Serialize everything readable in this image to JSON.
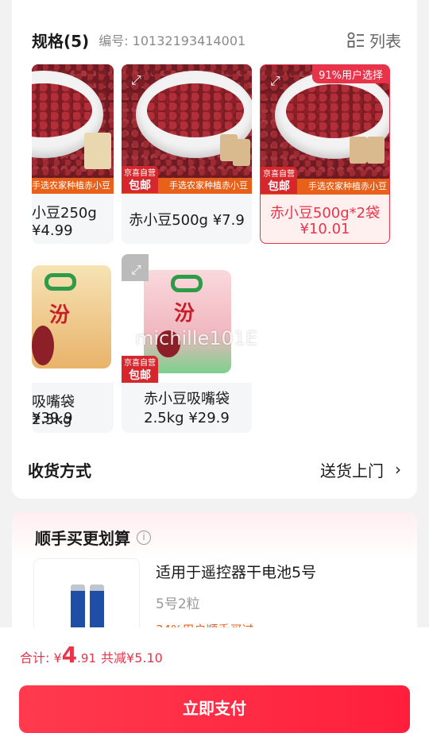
{
  "spec": {
    "title": "规格(5)",
    "code": "编号: 10132193414001",
    "list_label": "列表"
  },
  "options": [
    {
      "label_line1": "小豆250g",
      "label_line2": "¥4.99",
      "selected": false,
      "pack_text": "手选农家种植赤小豆"
    },
    {
      "label_line1": "赤小豆500g ¥7.9",
      "label_line2": "",
      "selected": false,
      "badge_top": "京喜自营",
      "badge_bottom": "包邮",
      "pack_text": "手选农家种植赤小豆"
    },
    {
      "label_line1": "赤小豆500g*2袋",
      "label_line2": "¥10.01",
      "selected": true,
      "pick_badge": "91%用户选择",
      "badge_top": "京喜自营",
      "badge_bottom": "包邮",
      "pack_text": "手选农家种植赤小豆"
    },
    {
      "label_line1": "吸嘴袋2.5kg",
      "label_line2": "¥39.9",
      "selected": false
    },
    {
      "label_line1": "赤小豆吸嘴袋",
      "label_line2": "2.5kg ¥29.9",
      "selected": false,
      "badge_top": "京喜自营",
      "badge_bottom": "包邮",
      "watermark": "michille101E"
    }
  ],
  "delivery": {
    "label": "收货方式",
    "value": "送货上门"
  },
  "bundle": {
    "title": "顺手买更划算",
    "name": "适用于遥控器干电池5号",
    "spec": "5号2粒",
    "sales": "34%用户顺手买过"
  },
  "checkout": {
    "total_prefix": "合计: ¥",
    "total_int": "4",
    "total_dec": ".91",
    "discount": "共减¥5.10",
    "pay_label": "立即支付"
  },
  "colors": {
    "accent": "#e8344b",
    "strip": "#e8611a"
  }
}
